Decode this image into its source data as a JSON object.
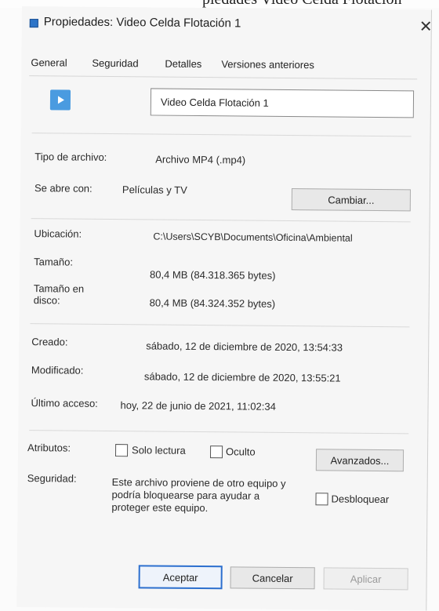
{
  "top_text": "piedades  Video Celda Flotación",
  "window": {
    "title": "Propiedades: Video Celda Flotación 1",
    "close_glyph": "✕"
  },
  "tabs": [
    {
      "label": "General"
    },
    {
      "label": "Seguridad"
    },
    {
      "label": "Detalles"
    },
    {
      "label": "Versiones anteriores"
    }
  ],
  "file": {
    "icon": "video-file-icon",
    "name_value": "Video Celda Flotación 1"
  },
  "type_section": {
    "type_label": "Tipo de archivo:",
    "type_value": "Archivo MP4 (.mp4)",
    "opens_label": "Se abre con:",
    "opens_value": "Películas y TV",
    "change_button": "Cambiar..."
  },
  "location_section": {
    "location_label": "Ubicación:",
    "location_value": "C:\\Users\\SCYB\\Documents\\Oficina\\Ambiental",
    "size_label": "Tamaño:",
    "size_value": "80,4 MB (84.318.365 bytes)",
    "disk_label_line1": "Tamaño en",
    "disk_label_line2": "disco:",
    "disk_value": "80,4 MB (84.324.352 bytes)"
  },
  "dates_section": {
    "created_label": "Creado:",
    "created_value": "sábado, 12 de diciembre de 2020, 13:54:33",
    "modified_label": "Modificado:",
    "modified_value": "sábado, 12 de diciembre de 2020, 13:55:21",
    "accessed_label": "Último acceso:",
    "accessed_value": "hoy, 22 de junio de 2021, 11:02:34"
  },
  "attributes_section": {
    "attributes_label": "Atributos:",
    "readonly_label": "Solo lectura",
    "hidden_label": "Oculto",
    "advanced_button": "Avanzados...",
    "security_label": "Seguridad:",
    "security_text": "Este archivo proviene de otro equipo y podría bloquearse para ayudar a proteger este equipo.",
    "unblock_label": "Desbloquear"
  },
  "footer": {
    "accept_button": "Aceptar",
    "cancel_button": "Cancelar",
    "apply_button": "Aplicar"
  }
}
